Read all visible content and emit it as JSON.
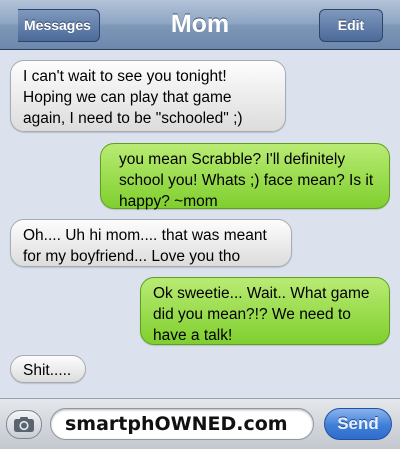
{
  "header": {
    "title": "Mom",
    "back_label": "Messages",
    "edit_label": "Edit"
  },
  "messages": [
    {
      "direction": "incoming",
      "text": "I can't wait to see you tonight! Hoping we can play that game again, I need to be \"schooled\" ;)"
    },
    {
      "direction": "outgoing",
      "text": "you mean Scrabble? I'll definitely school you! Whats ;) face mean? Is it happy? ~mom"
    },
    {
      "direction": "incoming",
      "text": "Oh.... Uh hi mom.... that was meant for my boyfriend... Love you tho"
    },
    {
      "direction": "outgoing",
      "text": "Ok sweetie... Wait.. What game did you mean?!? We need to have a talk!"
    },
    {
      "direction": "incoming",
      "text": "Shit....."
    }
  ],
  "composer": {
    "field_text": "smartphOWNED.com",
    "send_label": "Send",
    "camera_icon": "camera-icon"
  },
  "colors": {
    "incoming_bubble": "#e8e8e8",
    "outgoing_bubble": "#9ddd52",
    "navbar": "#8ea5c3",
    "send_button": "#3f7fd8"
  }
}
